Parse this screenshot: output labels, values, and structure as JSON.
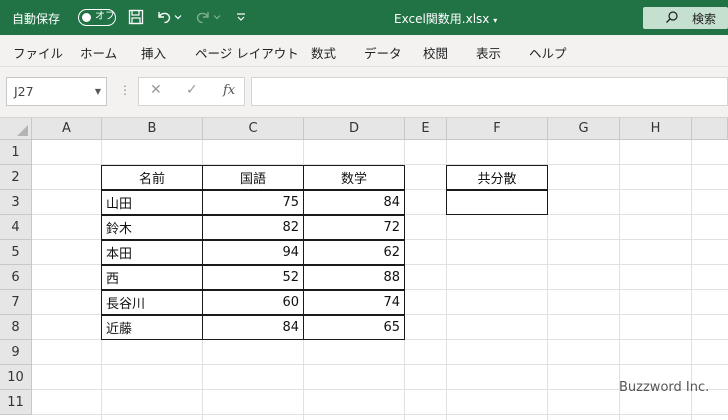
{
  "titlebar": {
    "autosave_label": "自動保存",
    "autosave_state": "オフ",
    "filename": "Excel関数用.xlsx",
    "search_label": "検索"
  },
  "ribbon": {
    "tabs": [
      "ファイル",
      "ホーム",
      "挿入",
      "ページ レイアウト",
      "数式",
      "データ",
      "校閲",
      "表示",
      "ヘルプ"
    ]
  },
  "formula_bar": {
    "name_box": "J27",
    "fx_label": "fx",
    "formula": ""
  },
  "sheet": {
    "columns": [
      "A",
      "B",
      "C",
      "D",
      "E",
      "F",
      "G",
      "H"
    ],
    "rows": [
      "1",
      "2",
      "3",
      "4",
      "5",
      "6",
      "7",
      "8",
      "9",
      "10",
      "11"
    ],
    "table": {
      "headers": [
        "名前",
        "国語",
        "数学"
      ],
      "rows": [
        [
          "山田",
          "75",
          "84"
        ],
        [
          "鈴木",
          "82",
          "72"
        ],
        [
          "本田",
          "94",
          "62"
        ],
        [
          "西",
          "52",
          "88"
        ],
        [
          "長谷川",
          "60",
          "74"
        ],
        [
          "近藤",
          "84",
          "65"
        ]
      ]
    },
    "covariance": {
      "header": "共分散",
      "value": ""
    }
  },
  "watermark": "Buzzword Inc.",
  "colors": {
    "titlebar": "#217346",
    "ribbon": "#f3f2f1"
  }
}
